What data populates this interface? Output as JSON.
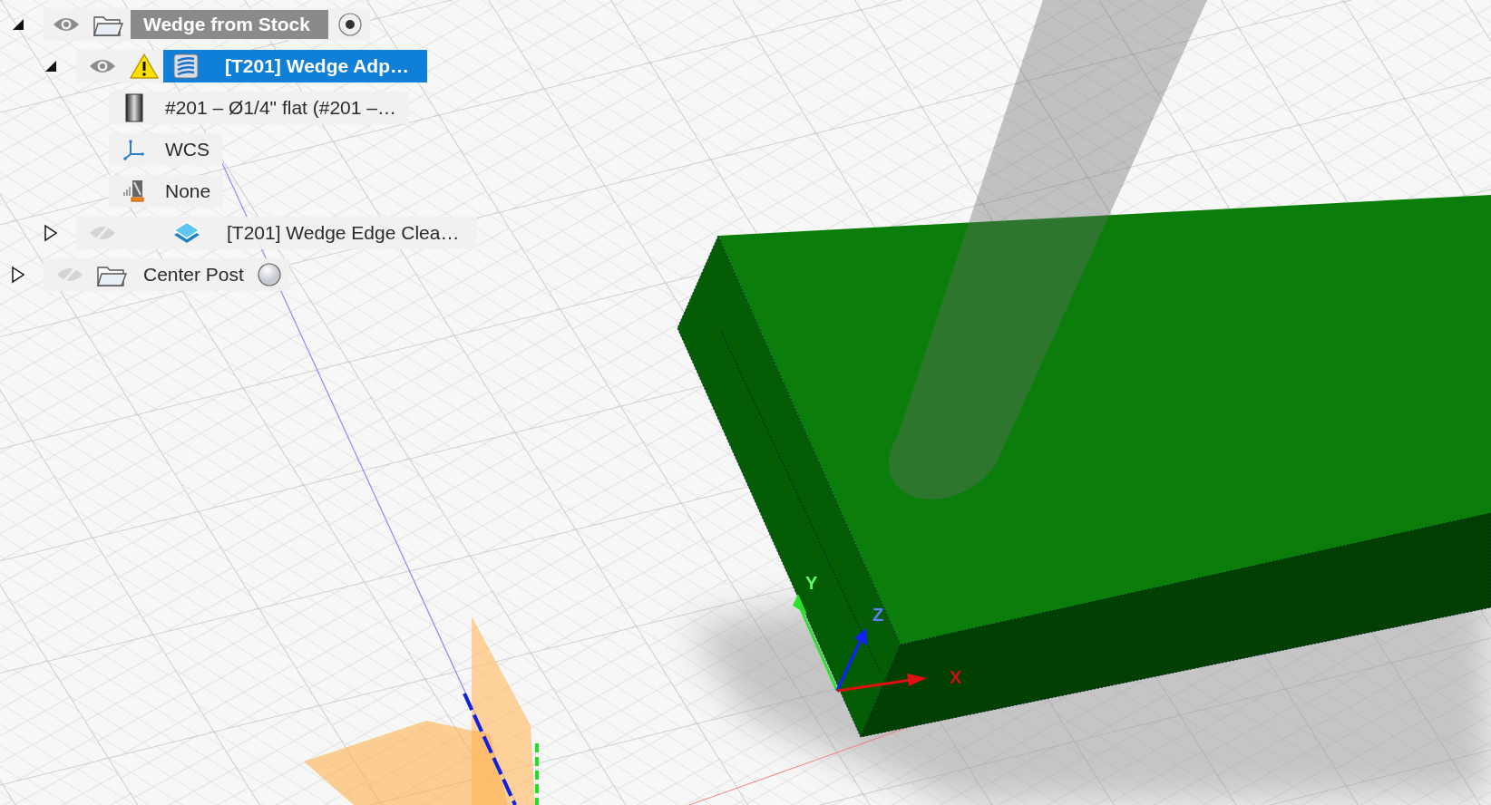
{
  "browser": {
    "items": [
      {
        "kind": "setup",
        "label": "Wedge from Stock",
        "expanded": true,
        "visible": true,
        "active": true,
        "selected": false,
        "children": [
          {
            "kind": "operation",
            "label": "[T201] Wedge Adp…",
            "expanded": true,
            "visible": true,
            "warning": true,
            "selected": true,
            "children": [
              {
                "kind": "tool",
                "label": "#201 – Ø1/4\" flat (#201 –…",
                "selected": false
              },
              {
                "kind": "wcs",
                "label": "WCS",
                "selected": false
              },
              {
                "kind": "machine",
                "label": "None",
                "selected": false
              }
            ]
          },
          {
            "kind": "operation",
            "label": "[T201] Wedge Edge Clea…",
            "expanded": false,
            "visible": false,
            "warning": false,
            "selected": false
          }
        ]
      },
      {
        "kind": "setup",
        "label": "Center Post",
        "expanded": false,
        "visible": false,
        "active": false,
        "selected": false
      }
    ]
  },
  "viewport": {
    "axis_labels": {
      "x": "X",
      "y": "Y",
      "z": "Z"
    }
  }
}
